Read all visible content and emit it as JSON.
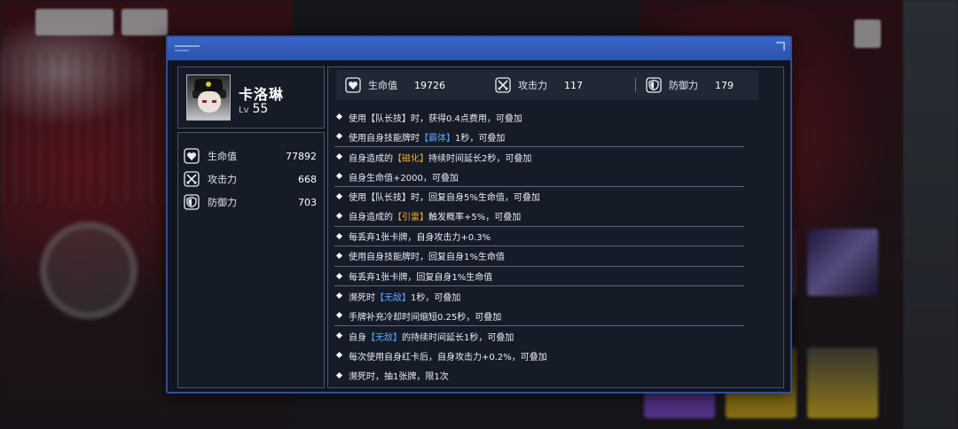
{
  "character": {
    "name": "卡洛琳",
    "level_prefix": "Lv",
    "level": "55"
  },
  "total_stats": [
    {
      "icon": "heart-icon",
      "label": "生命值",
      "value": "77892"
    },
    {
      "icon": "crossed-swords-icon",
      "label": "攻击力",
      "value": "668"
    },
    {
      "icon": "shield-icon",
      "label": "防御力",
      "value": "703"
    }
  ],
  "base_stats": [
    {
      "icon": "heart-icon",
      "label": "生命值",
      "value": "19726"
    },
    {
      "icon": "crossed-swords-icon",
      "label": "攻击力",
      "value": "117"
    },
    {
      "icon": "shield-icon",
      "label": "防御力",
      "value": "179"
    }
  ],
  "effects": [
    {
      "pre": "使用【队长技】时，获得0.4点费用，可叠加",
      "hl": "",
      "post": "",
      "hl_color": ""
    },
    {
      "pre": "使用自身技能牌时",
      "hl": "【霸体】",
      "post": "1秒，可叠加",
      "hl_color": "#5aa7ff"
    },
    {
      "pre": "自身造成的",
      "hl": "【磁化】",
      "post": "持续时间延长2秒，可叠加",
      "hl_color": "#f4a52a"
    },
    {
      "pre": "自身生命值+2000，可叠加",
      "hl": "",
      "post": "",
      "hl_color": ""
    },
    {
      "pre": "使用【队长技】时，回复自身5%生命值，可叠加",
      "hl": "",
      "post": "",
      "hl_color": ""
    },
    {
      "pre": "自身造成的",
      "hl": "【引雷】",
      "post": "触发概率+5%，可叠加",
      "hl_color": "#f4a52a"
    },
    {
      "pre": "每丢弃1张卡牌，自身攻击力+0.3%",
      "hl": "",
      "post": "",
      "hl_color": ""
    },
    {
      "pre": "使用自身技能牌时，回复自身1%生命值",
      "hl": "",
      "post": "",
      "hl_color": ""
    },
    {
      "pre": "每丢弃1张卡牌，回复自身1%生命值",
      "hl": "",
      "post": "",
      "hl_color": ""
    },
    {
      "pre": "濒死时",
      "hl": "【无敌】",
      "post": "1秒，可叠加",
      "hl_color": "#5aa7ff"
    },
    {
      "pre": "手牌补充冷却时间缩短0.25秒，可叠加",
      "hl": "",
      "post": "",
      "hl_color": ""
    },
    {
      "pre": "自身",
      "hl": "【无敌】",
      "post": "的持续时间延长1秒，可叠加",
      "hl_color": "#5aa7ff"
    },
    {
      "pre": "每次使用自身红卡后，自身攻击力+0.2%，可叠加",
      "hl": "",
      "post": "",
      "hl_color": ""
    },
    {
      "pre": "濒死时，抽1张牌，限1次",
      "hl": "",
      "post": "",
      "hl_color": ""
    }
  ],
  "colors": {
    "header_blue": "#3866c8",
    "highlight_orange": "#f4a52a",
    "highlight_blue": "#5aa7ff"
  }
}
